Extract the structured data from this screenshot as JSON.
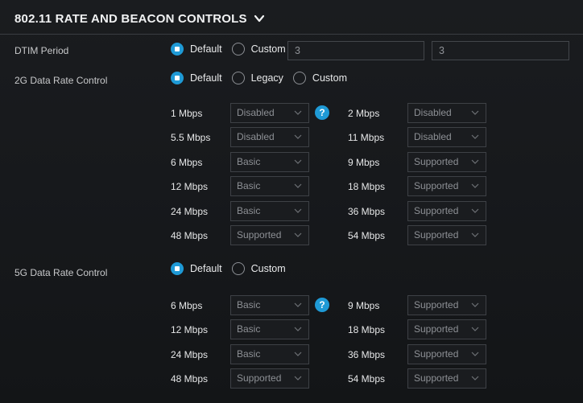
{
  "header": {
    "title": "802.11 RATE AND BEACON CONTROLS",
    "icon": "chevron-down-icon"
  },
  "dtim": {
    "label": "DTIM Period",
    "options": [
      "Default",
      "Custom"
    ],
    "selected": "Default",
    "value1": "3",
    "value2": "3"
  },
  "rate2g": {
    "label": "2G Data Rate Control",
    "options": [
      "Default",
      "Legacy",
      "Custom"
    ],
    "selected": "Default",
    "left": [
      {
        "rate": "1 Mbps",
        "value": "Disabled"
      },
      {
        "rate": "5.5 Mbps",
        "value": "Disabled"
      },
      {
        "rate": "6 Mbps",
        "value": "Basic"
      },
      {
        "rate": "12 Mbps",
        "value": "Basic"
      },
      {
        "rate": "24 Mbps",
        "value": "Basic"
      },
      {
        "rate": "48 Mbps",
        "value": "Supported"
      }
    ],
    "right": [
      {
        "rate": "2 Mbps",
        "value": "Disabled"
      },
      {
        "rate": "11 Mbps",
        "value": "Disabled"
      },
      {
        "rate": "9 Mbps",
        "value": "Supported"
      },
      {
        "rate": "18 Mbps",
        "value": "Supported"
      },
      {
        "rate": "36 Mbps",
        "value": "Supported"
      },
      {
        "rate": "54 Mbps",
        "value": "Supported"
      }
    ]
  },
  "rate5g": {
    "label": "5G Data Rate Control",
    "options": [
      "Default",
      "Custom"
    ],
    "selected": "Default",
    "left": [
      {
        "rate": "6 Mbps",
        "value": "Basic"
      },
      {
        "rate": "12 Mbps",
        "value": "Basic"
      },
      {
        "rate": "24 Mbps",
        "value": "Basic"
      },
      {
        "rate": "48 Mbps",
        "value": "Supported"
      }
    ],
    "right": [
      {
        "rate": "9 Mbps",
        "value": "Supported"
      },
      {
        "rate": "18 Mbps",
        "value": "Supported"
      },
      {
        "rate": "36 Mbps",
        "value": "Supported"
      },
      {
        "rate": "54 Mbps",
        "value": "Supported"
      }
    ]
  },
  "help": {
    "glyph": "?"
  },
  "colors": {
    "accent": "#1f9ad6",
    "background": "#17191c",
    "divider": "#3a3d42"
  }
}
